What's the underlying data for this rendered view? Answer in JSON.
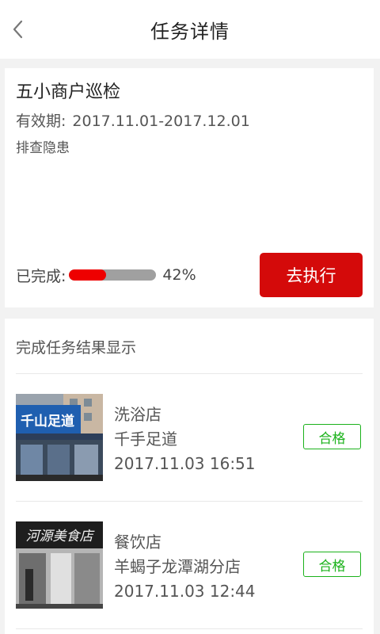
{
  "header": {
    "title": "任务详情"
  },
  "task": {
    "title": "五小商户巡检",
    "validity_label": "有效期:",
    "validity_range": "2017.11.01-2017.12.01",
    "description": "排查隐患",
    "progress_label": "已完成:",
    "progress_value": 42,
    "progress_text": "42%",
    "execute_label": "去执行"
  },
  "results": {
    "title": "完成任务结果显示",
    "items": [
      {
        "category": "洗浴店",
        "name": "千手足道",
        "datetime": "2017.11.03 16:51",
        "status": "合格",
        "sign_text": "千山足道"
      },
      {
        "category": "餐饮店",
        "name": "羊蝎子龙潭湖分店",
        "datetime": "2017.11.03 12:44",
        "status": "合格",
        "sign_text": "河源美食店"
      }
    ]
  },
  "colors": {
    "accent": "#d40a0a",
    "progress_fill": "#ee0000",
    "progress_track": "#a0a0a0",
    "status_pass": "#1bb21b"
  }
}
